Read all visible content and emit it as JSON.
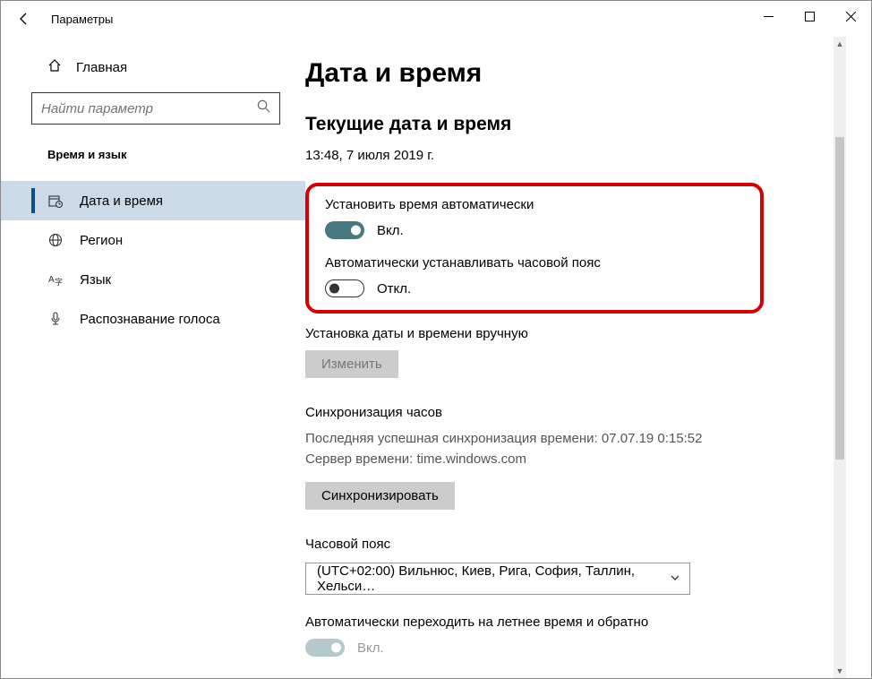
{
  "titlebar": {
    "title": "Параметры"
  },
  "sidebar": {
    "home": "Главная",
    "search_placeholder": "Найти параметр",
    "section": "Время и язык",
    "items": [
      {
        "label": "Дата и время"
      },
      {
        "label": "Регион"
      },
      {
        "label": "Язык"
      },
      {
        "label": "Распознавание голоса"
      }
    ]
  },
  "main": {
    "title": "Дата и время",
    "current_heading": "Текущие дата и время",
    "current_value": "13:48, 7 июля 2019 г.",
    "auto_time": {
      "label": "Установить время автоматически",
      "state": "Вкл."
    },
    "auto_tz": {
      "label": "Автоматически устанавливать часовой пояс",
      "state": "Откл."
    },
    "manual": {
      "label": "Установка даты и времени вручную",
      "button": "Изменить"
    },
    "sync": {
      "heading": "Синхронизация часов",
      "last": "Последняя успешная синхронизация времени: 07.07.19 0:15:52",
      "server": "Сервер времени: time.windows.com",
      "button": "Синхронизировать"
    },
    "tz": {
      "heading": "Часовой пояс",
      "value": "(UTC+02:00) Вильнюс, Киев, Рига, София, Таллин, Хельси…"
    },
    "dst": {
      "label": "Автоматически переходить на летнее время и обратно",
      "state": "Вкл."
    }
  }
}
